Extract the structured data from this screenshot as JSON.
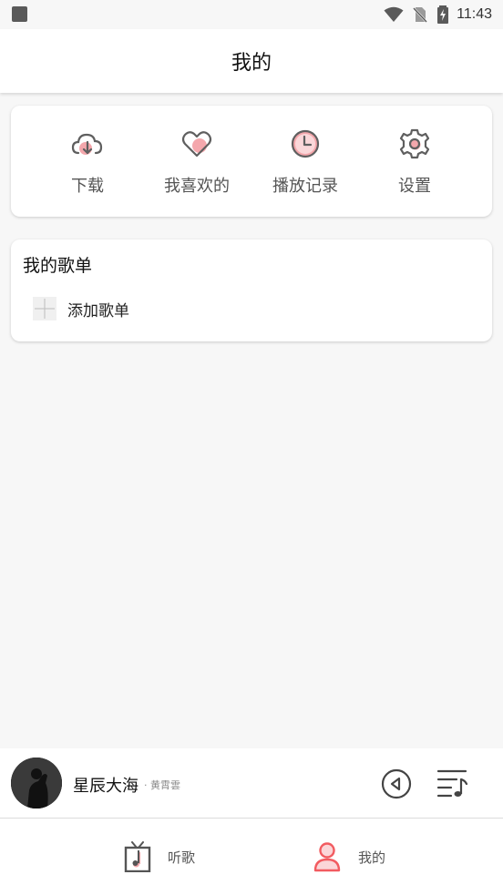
{
  "status_bar": {
    "time": "11:43"
  },
  "header": {
    "title": "我的"
  },
  "quick_actions": [
    {
      "label": "下载",
      "icon": "cloud-download-icon"
    },
    {
      "label": "我喜欢的",
      "icon": "heart-icon"
    },
    {
      "label": "播放记录",
      "icon": "clock-icon"
    },
    {
      "label": "设置",
      "icon": "gear-icon"
    }
  ],
  "playlists": {
    "title": "我的歌单",
    "add_label": "添加歌单"
  },
  "player": {
    "song_title": "星辰大海",
    "artist": "· 黄霄雲"
  },
  "bottom_nav": [
    {
      "label": "听歌",
      "icon": "music-tv-icon"
    },
    {
      "label": "我的",
      "icon": "person-icon",
      "active": true
    }
  ],
  "colors": {
    "accent": "#f25b60",
    "accent_soft": "#f4a7ac",
    "icon_gray": "#5f5f5f"
  }
}
